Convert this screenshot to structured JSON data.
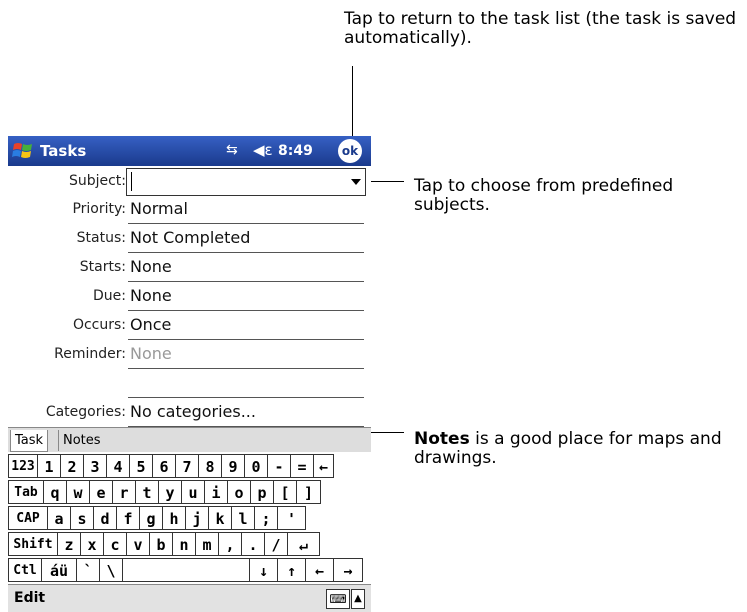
{
  "callouts": {
    "top": "Tap to return to the task list (the task is saved automatically).",
    "subject": "Tap to choose from predefined subjects.",
    "notes_bold": "Notes",
    "notes_rest": " is a good place for maps and drawings."
  },
  "titlebar": {
    "title": "Tasks",
    "time": "8:49",
    "ok_label": "ok",
    "connectivity_icon": "connectivity-icon",
    "volume_icon": "volume-icon"
  },
  "form": {
    "fields": [
      {
        "label": "Subject:",
        "value": ""
      },
      {
        "label": "Priority:",
        "value": "Normal"
      },
      {
        "label": "Status:",
        "value": "Not Completed"
      },
      {
        "label": "Starts:",
        "value": "None"
      },
      {
        "label": "Due:",
        "value": "None"
      },
      {
        "label": "Occurs:",
        "value": "Once"
      },
      {
        "label": "Reminder:",
        "value": "None"
      },
      {
        "label": "Categories:",
        "value": "No categories..."
      }
    ]
  },
  "tabs": {
    "task": "Task",
    "notes": "Notes"
  },
  "keyboard": {
    "row1": [
      "123",
      "1",
      "2",
      "3",
      "4",
      "5",
      "6",
      "7",
      "8",
      "9",
      "0",
      "-",
      "=",
      "←"
    ],
    "row2": [
      "Tab",
      "q",
      "w",
      "e",
      "r",
      "t",
      "y",
      "u",
      "i",
      "o",
      "p",
      "[",
      "]"
    ],
    "row3": [
      "CAP",
      "a",
      "s",
      "d",
      "f",
      "g",
      "h",
      "j",
      "k",
      "l",
      ";",
      "'"
    ],
    "row4": [
      "Shift",
      "z",
      "x",
      "c",
      "v",
      "b",
      "n",
      "m",
      ",",
      ".",
      "/",
      "↵"
    ],
    "row5": [
      "Ctl",
      "áü",
      "`",
      "\\",
      " ",
      "↓",
      "↑",
      "←",
      "→"
    ]
  },
  "menubar": {
    "edit": "Edit",
    "kb_icon": "keyboard-icon",
    "kb_arrow": "▲"
  }
}
